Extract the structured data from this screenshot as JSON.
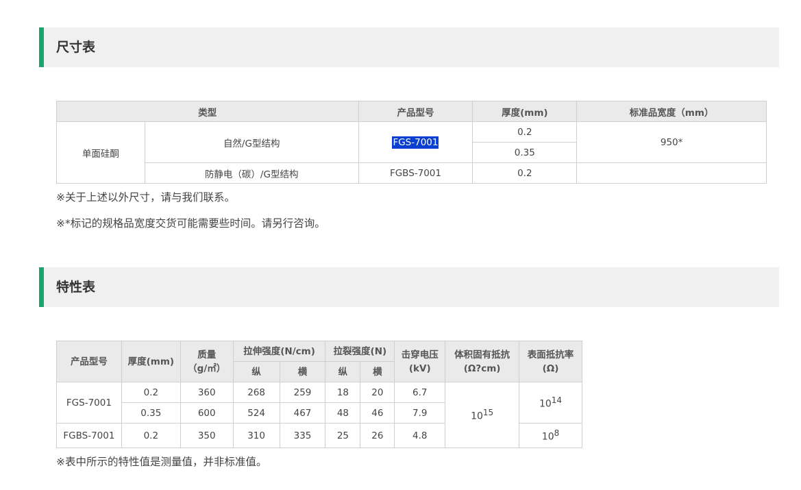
{
  "size_section": {
    "title": "尺寸表",
    "table": {
      "headers": [
        "类型",
        "产品型号",
        "厚度(mm)",
        "标准品宽度（mm）"
      ],
      "group": "单面硅酮",
      "row1_type": "自然/G型结构",
      "row1_model": "FGS-7001",
      "row1_thickness_a": "0.2",
      "row1_thickness_b": "0.35",
      "width": "950*",
      "row2_type": "防静电（碳）/G型结构",
      "row2_model": "FGBS-7001",
      "row2_thickness": "0.2"
    },
    "note1": "※关于上述以外尺寸，请与我们联系。",
    "note2": "※*标记的规格品宽度交货可能需要些时间。请另行咨询。"
  },
  "prop_section": {
    "title": "特性表",
    "headers": {
      "model": "产品型号",
      "thickness": "厚度(mm)",
      "mass": "质量",
      "mass_unit": "（g/㎡）",
      "tensile": "拉伸强度(N/cm)",
      "tear": "拉裂强度(N)",
      "longitudinal": "纵",
      "transverse": "横",
      "breakdown": "击穿电压",
      "breakdown_unit": "(kV)",
      "volume_res": "体积固有抵抗",
      "volume_res_unit": "(Ω?cm)",
      "surface_res": "表面抵抗率",
      "surface_res_unit": "(Ω)"
    },
    "rows": [
      {
        "model": "FGS-7001",
        "thickness": "0.2",
        "mass": "360",
        "tensile_l": "268",
        "tensile_t": "259",
        "tear_l": "18",
        "tear_t": "20",
        "breakdown": "6.7"
      },
      {
        "thickness": "0.35",
        "mass": "600",
        "tensile_l": "524",
        "tensile_t": "467",
        "tear_l": "48",
        "tear_t": "46",
        "breakdown": "7.9"
      },
      {
        "model": "FGBS-7001",
        "thickness": "0.2",
        "mass": "350",
        "tensile_l": "310",
        "tensile_t": "335",
        "tear_l": "25",
        "tear_t": "26",
        "breakdown": "4.8"
      }
    ],
    "volume_base": "10",
    "volume_exp": "15",
    "surface1_base": "10",
    "surface1_exp": "14",
    "surface2_base": "10",
    "surface2_exp": "8",
    "note": "※表中所示的特性值是测量值，并非标准值。"
  },
  "colors": {
    "accent": "#1aa46e",
    "highlight": "#0a3fcf"
  }
}
